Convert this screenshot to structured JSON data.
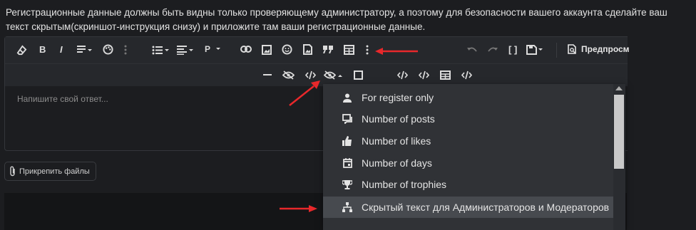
{
  "intro_text": "Регистрационные данные должны быть видны только проверяющему администратору, а поэтому для безопасности вашего аккаунта сделайте ваш текст скрытым(скриншот-инструкция снизу) и приложите там ваши регистрационные данные.",
  "editor": {
    "placeholder": "Напишите свой ответ...",
    "paragraph_label": "P",
    "preview_label": "Предпросм"
  },
  "attach_label": "Прикрепить файлы",
  "dropdown_items": [
    {
      "label": "For register only",
      "icon": "user-icon"
    },
    {
      "label": "Number of posts",
      "icon": "comments-icon"
    },
    {
      "label": "Number of likes",
      "icon": "thumbs-up-icon"
    },
    {
      "label": "Number of days",
      "icon": "calendar-icon"
    },
    {
      "label": "Number of trophies",
      "icon": "trophy-icon"
    },
    {
      "label": "Скрытый текст для Администраторов и Модераторов",
      "icon": "sitemap-icon"
    }
  ],
  "colors": {
    "arrow": "#e8282b",
    "background": "#1c1d20",
    "toolbar": "#26282c"
  }
}
